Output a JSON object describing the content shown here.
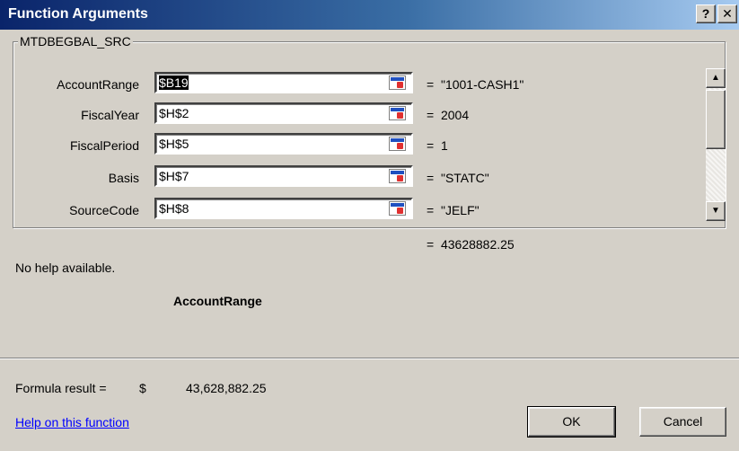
{
  "window": {
    "title": "Function Arguments",
    "help_button": "?",
    "close_button": "✕"
  },
  "group": {
    "label": "MTDBEGBAL_SRC"
  },
  "arguments": [
    {
      "label": "AccountRange",
      "value": "$B19",
      "result": "\"1001-CASH1\""
    },
    {
      "label": "FiscalYear",
      "value": "$H$2",
      "result": "2004"
    },
    {
      "label": "FiscalPeriod",
      "value": "$H$5",
      "result": "1"
    },
    {
      "label": "Basis",
      "value": " $H$7",
      "result": "\"STATC\""
    },
    {
      "label": "SourceCode",
      "value": "$H$8",
      "result": "\"JELF\""
    }
  ],
  "equals": "=",
  "function_result": "43628882.25",
  "help_text": "No help available.",
  "current_arg": "AccountRange",
  "formula_result": {
    "label": "Formula result =",
    "currency": "$",
    "value": "43,628,882.25"
  },
  "help_link": "Help on this function",
  "buttons": {
    "ok": "OK",
    "cancel": "Cancel"
  },
  "scrollbar": {
    "up_icon": "▲",
    "down_icon": "▼"
  }
}
